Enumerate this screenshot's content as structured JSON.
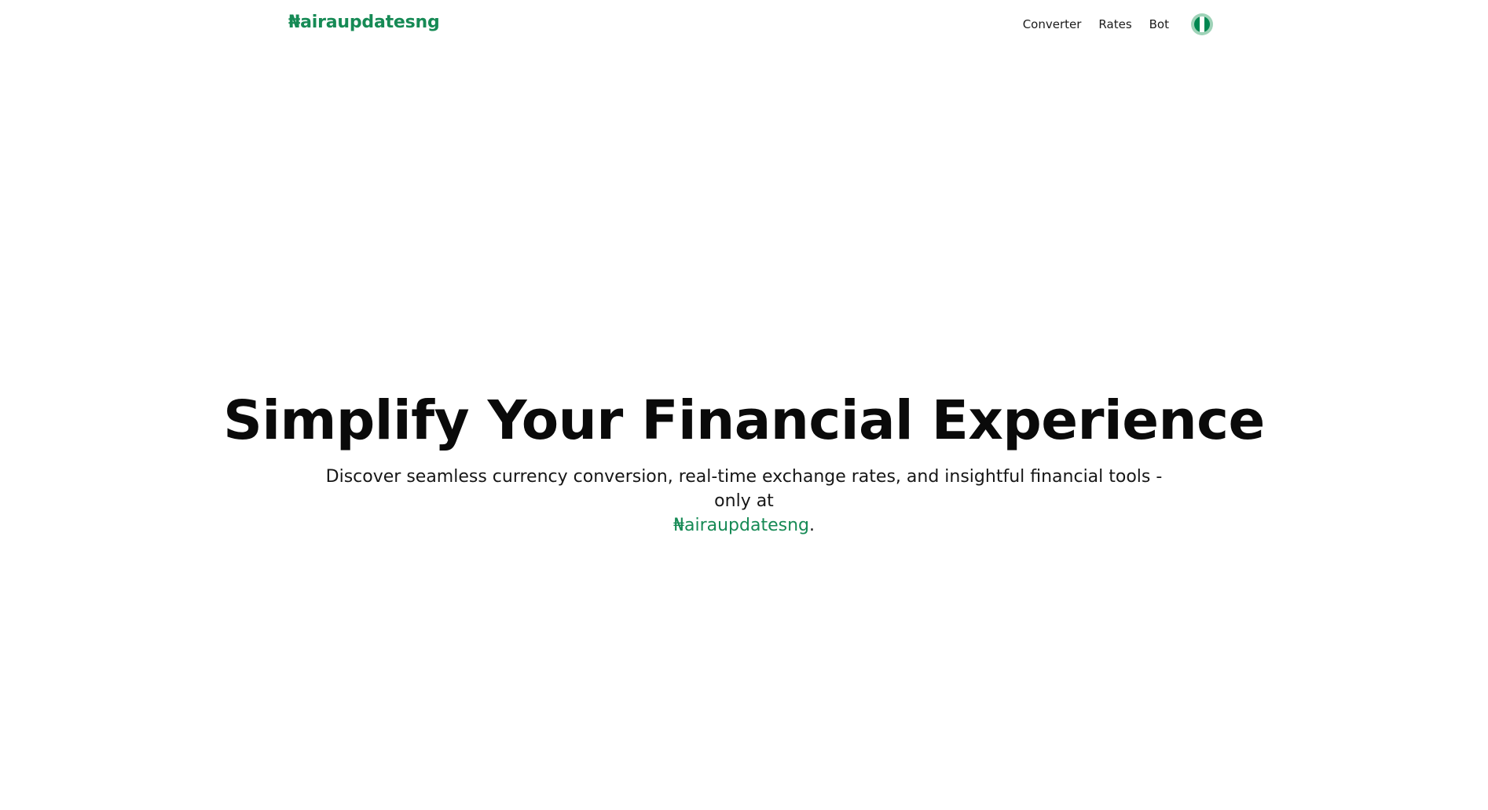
{
  "header": {
    "brand": "₦airaupdatesng",
    "nav": [
      {
        "label": "Converter"
      },
      {
        "label": "Rates"
      },
      {
        "label": "Bot"
      }
    ],
    "flag_icon": "nigeria-flag-icon",
    "flag_colors": [
      "#008751",
      "#ffffff",
      "#008751"
    ]
  },
  "hero": {
    "title": "Simplify Your Financial Experience",
    "subtitle": "Discover seamless currency conversion, real-time exchange rates, and insightful financial tools - only at",
    "brand": "₦airaupdatesng",
    "period": "."
  },
  "colors": {
    "accent": "#168a55",
    "text": "#111111",
    "background": "#ffffff"
  }
}
